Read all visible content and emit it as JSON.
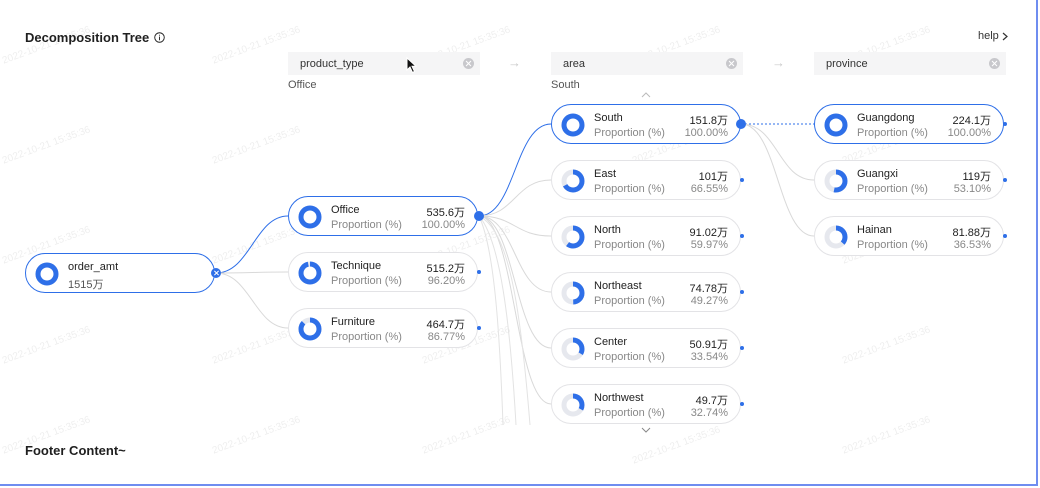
{
  "title": "Decomposition Tree",
  "help_label": "help",
  "footer": "Footer Content~",
  "watermark": "2022-10-21 15:35:36",
  "accent": "#2e6fe8",
  "columns": [
    {
      "header": "product_type",
      "selected": "Office"
    },
    {
      "header": "area",
      "selected": "South"
    },
    {
      "header": "province",
      "selected": ""
    }
  ],
  "proportion_label": "Proportion (%)",
  "root": {
    "name": "order_amt",
    "value": "1515万",
    "ratio": 1.0
  },
  "product_type": [
    {
      "name": "Office",
      "value": "535.6万",
      "pct": "100.00%",
      "ratio": 1.0
    },
    {
      "name": "Technique",
      "value": "515.2万",
      "pct": "96.20%",
      "ratio": 0.962
    },
    {
      "name": "Furniture",
      "value": "464.7万",
      "pct": "86.77%",
      "ratio": 0.8677
    }
  ],
  "area": [
    {
      "name": "South",
      "value": "151.8万",
      "pct": "100.00%",
      "ratio": 1.0
    },
    {
      "name": "East",
      "value": "101万",
      "pct": "66.55%",
      "ratio": 0.6655
    },
    {
      "name": "North",
      "value": "91.02万",
      "pct": "59.97%",
      "ratio": 0.5997
    },
    {
      "name": "Northeast",
      "value": "74.78万",
      "pct": "49.27%",
      "ratio": 0.4927
    },
    {
      "name": "Center",
      "value": "50.91万",
      "pct": "33.54%",
      "ratio": 0.3354
    },
    {
      "name": "Northwest",
      "value": "49.7万",
      "pct": "32.74%",
      "ratio": 0.3274
    }
  ],
  "province": [
    {
      "name": "Guangdong",
      "value": "224.1万",
      "pct": "100.00%",
      "ratio": 1.0
    },
    {
      "name": "Guangxi",
      "value": "119万",
      "pct": "53.10%",
      "ratio": 0.531
    },
    {
      "name": "Hainan",
      "value": "81.88万",
      "pct": "36.53%",
      "ratio": 0.3653
    }
  ]
}
